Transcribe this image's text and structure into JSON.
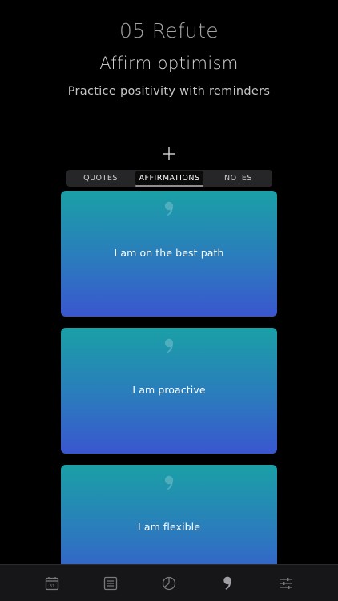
{
  "header": {
    "step_title": "05 Refute",
    "headline": "Affirm optimism",
    "subtitle": "Practice positivity with reminders"
  },
  "segments": {
    "items": [
      "QUOTES",
      "AFFIRMATIONS",
      "NOTES"
    ],
    "selected": "AFFIRMATIONS"
  },
  "cards": [
    {
      "text": "I am on the best path"
    },
    {
      "text": "I am proactive"
    },
    {
      "text": "I am flexible"
    }
  ],
  "tabbar": {
    "items": [
      {
        "icon": "calendar-icon",
        "label": "31"
      },
      {
        "icon": "list-icon"
      },
      {
        "icon": "chart-icon"
      },
      {
        "icon": "quote-icon"
      },
      {
        "icon": "sliders-icon"
      }
    ]
  },
  "colors": {
    "background": "#000000",
    "card_top": "#1aa0a6",
    "card_bottom": "#3a56cf",
    "tab_inactive": "#7a7a7e",
    "tab_active": "#a0a0a4"
  }
}
